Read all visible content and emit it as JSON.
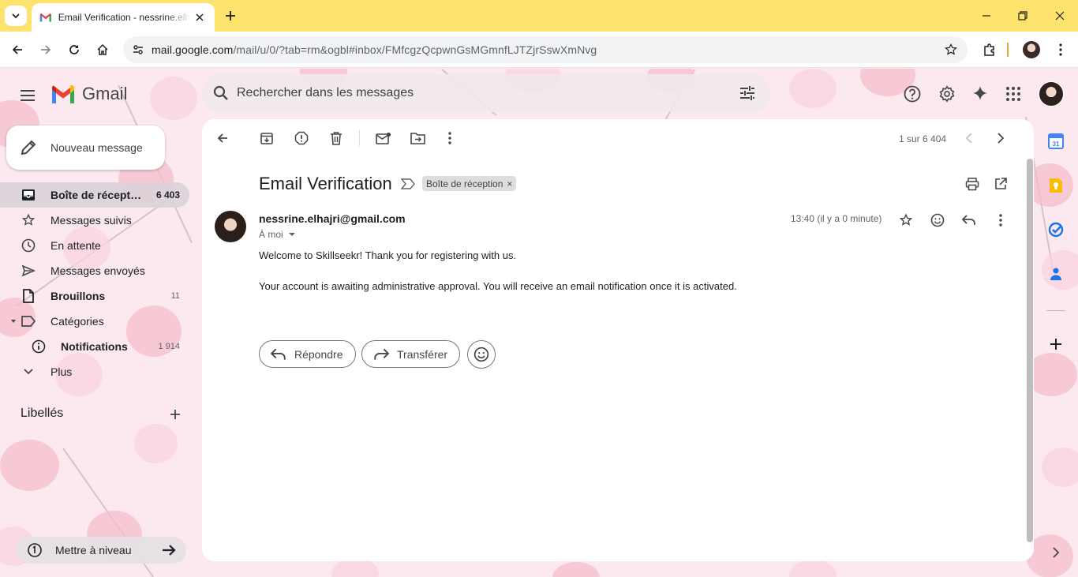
{
  "browser": {
    "tab_title": "Email Verification - nessrine.elhajri@gmail.com - Gmail",
    "url_host": "mail.google.com",
    "url_path": "/mail/u/0/?tab=rm&ogbl#inbox/FMfcgzQcpwnGsMGmnfLJTZjrSswXmNvg"
  },
  "gmail": {
    "logo_text": "Gmail",
    "search_placeholder": "Rechercher dans les messages",
    "compose_label": "Nouveau message",
    "nav": [
      {
        "label": "Boîte de récept…",
        "count": "6 403"
      },
      {
        "label": "Messages suivis",
        "count": ""
      },
      {
        "label": "En attente",
        "count": ""
      },
      {
        "label": "Messages envoyés",
        "count": ""
      },
      {
        "label": "Brouillons",
        "count": "11"
      },
      {
        "label": "Catégories",
        "count": ""
      },
      {
        "label": "Notifications",
        "count": "1 914"
      },
      {
        "label": "Plus",
        "count": ""
      }
    ],
    "labels_title": "Libellés",
    "upgrade_label": "Mettre à niveau",
    "pager": "1 sur 6 404"
  },
  "message": {
    "subject": "Email Verification",
    "label_chip": "Boîte de réception",
    "label_chip_close": "×",
    "sender": "nessrine.elhajri@gmail.com",
    "to": "À moi",
    "time": "13:40 (il y a 0 minute)",
    "body_line1": "Welcome to Skillseekr! Thank you for registering with us.",
    "body_line2": "Your account is awaiting administrative approval. You will receive an email notification once it is activated.",
    "reply_label": "Répondre",
    "forward_label": "Transférer"
  },
  "colors": {
    "tabbar": "#fde26d",
    "background": "#fce9ef",
    "blossom": "#f6bdcc"
  }
}
